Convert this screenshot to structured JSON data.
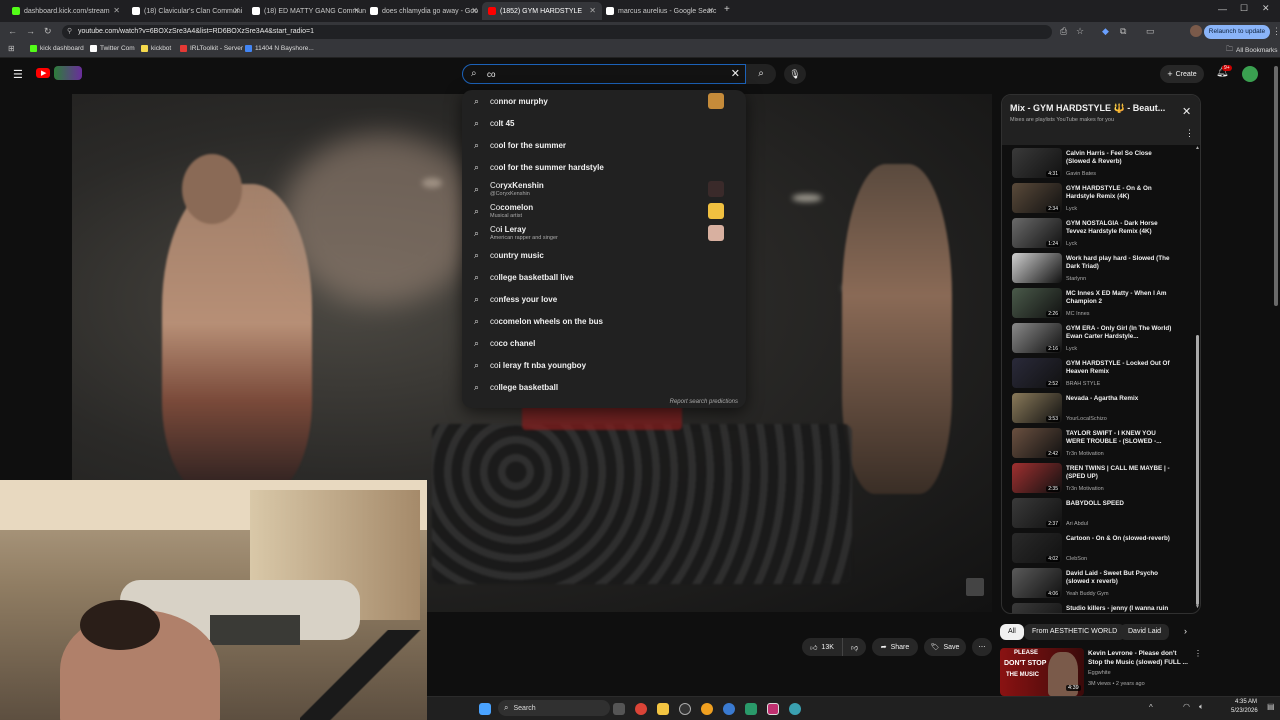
{
  "browser": {
    "tabs": [
      {
        "label": "dashboard.kick.com/stream",
        "favicon_color": "#53fc18",
        "active": false
      },
      {
        "label": "(18) Clavicular's Clan Communi",
        "favicon_color": "#ffffff",
        "active": false
      },
      {
        "label": "(18) ED MATTY GANG Commun",
        "favicon_color": "#ffffff",
        "active": false
      },
      {
        "label": "does chlamydia go away - Goo",
        "favicon_color": "#ffffff",
        "active": false
      },
      {
        "label": "(1852) GYM HARDSTYLE",
        "favicon_color": "#ff0000",
        "active": true
      },
      {
        "label": "marcus aurelius - Google Searc",
        "favicon_color": "#ffffff",
        "active": false
      }
    ],
    "new_tab_label": "+",
    "url": "youtube.com/watch?v=6BOXzSre3A4&list=RD6BOXzSre3A4&start_radio=1",
    "relaunch_label": "Relaunch to update",
    "bookmarks": [
      {
        "label": "kick dashboard",
        "color": "#53fc18"
      },
      {
        "label": "Twitter Com",
        "color": "#ffffff"
      },
      {
        "label": "kickbot",
        "color": "#f5d94c"
      },
      {
        "label": "IRLToolkit - Server",
        "color": "#e53935"
      },
      {
        "label": "11404 N Bayshore...",
        "color": "#4285f4"
      }
    ],
    "all_bookmarks_label": "All Bookmarks"
  },
  "youtube": {
    "search_value": "co",
    "create_label": "Create",
    "notification_count": "9+",
    "suggestions": [
      {
        "label": "connor murphy",
        "sub": "",
        "thumb": true,
        "thumb_color": "#c58b3a"
      },
      {
        "label": "colt 45",
        "sub": "",
        "thumb": false
      },
      {
        "label": "cool for the summer",
        "sub": "",
        "thumb": false
      },
      {
        "label": "cool for the summer hardstyle",
        "sub": "",
        "thumb": false
      },
      {
        "label": "CoryxKenshin",
        "sub": "@CoryxKenshin",
        "thumb": true,
        "thumb_color": "#3a2a2a"
      },
      {
        "label": "Cocomelon",
        "sub": "Musical artist",
        "thumb": true,
        "thumb_color": "#f0c040"
      },
      {
        "label": "Coi Leray",
        "sub": "American rapper and singer",
        "thumb": true,
        "thumb_color": "#d8b0a0"
      },
      {
        "label": "country music",
        "sub": "",
        "thumb": false
      },
      {
        "label": "college basketball live",
        "sub": "",
        "thumb": false
      },
      {
        "label": "confess your love",
        "sub": "",
        "thumb": false
      },
      {
        "label": "cocomelon wheels on the bus",
        "sub": "",
        "thumb": false
      },
      {
        "label": "coco chanel",
        "sub": "",
        "thumb": false
      },
      {
        "label": "coi leray ft nba youngboy",
        "sub": "",
        "thumb": false
      },
      {
        "label": "college basketball",
        "sub": "",
        "thumb": false
      }
    ],
    "report_label": "Report search predictions",
    "mix": {
      "title": "Mix - GYM HARDSTYLE 🔱 - Beaut...",
      "subtitle": "Mixes are playlists YouTube makes for you",
      "items": [
        {
          "title": "Calvin Harris - Feel So Close (Slowed & Reverb)",
          "channel": "Gavin Bates",
          "duration": "4:31",
          "color": "#3a3a3a"
        },
        {
          "title": "GYM HARDSTYLE - On & On Hardstyle Remix (4K)",
          "channel": "Lyck",
          "duration": "2:34",
          "color": "#5a4a3a"
        },
        {
          "title": "GYM NOSTALGIA - Dark Horse Tevvez Hardstyle Remix (4K)",
          "channel": "Lyck",
          "duration": "1:24",
          "color": "#6a6a6a"
        },
        {
          "title": "Work hard play hard - Slowed (The Dark Triad)",
          "channel": "Starlynn",
          "duration": "",
          "color": "#d0d0d0"
        },
        {
          "title": "MC Innes X ED Matty - When I Am Champion 2",
          "channel": "MC Innes",
          "duration": "2:26",
          "color": "#4a5a4a"
        },
        {
          "title": "GYM ERA - Only Girl (In The World) Ewan Carter Hardstyle...",
          "channel": "Lyck",
          "duration": "2:16",
          "color": "#8a8a8a"
        },
        {
          "title": "GYM HARDSTYLE - Locked Out Of Heaven Remix",
          "channel": "BRAH STYLE",
          "duration": "2:52",
          "color": "#2a2a3a"
        },
        {
          "title": "Nevada - Agartha Remix",
          "channel": "YourLocalSchizo",
          "duration": "3:53",
          "color": "#8a7a5a"
        },
        {
          "title": "TAYLOR SWIFT - I KNEW YOU WERE TROUBLE - (SLOWED -...",
          "channel": "Tr3n Motivation",
          "duration": "2:42",
          "color": "#6a5040"
        },
        {
          "title": "TREN TWINS | CALL ME MAYBE | - (SPED UP)",
          "channel": "Tr3n Motivation",
          "duration": "2:35",
          "color": "#a03030"
        },
        {
          "title": "BABYDOLL SPEED",
          "channel": "Ari Abdul",
          "duration": "2:37",
          "color": "#3a3a3a"
        },
        {
          "title": "Cartoon - On & On (slowed-reverb)",
          "channel": "ClebSon",
          "duration": "4:02",
          "color": "#2a2a2a"
        },
        {
          "title": "David Laid - Sweet But Psycho (slowed x reverb)",
          "channel": "Yeah Buddy Gym",
          "duration": "4:06",
          "color": "#5a5a5a"
        },
        {
          "title": "Studio killers - jenny (I wanna ruin our friendship) (Slowed...",
          "channel": "",
          "duration": "",
          "color": "#3a3a3a"
        }
      ]
    },
    "chips": [
      {
        "label": "All",
        "selected": true
      },
      {
        "label": "From AESTHETIC WORLD",
        "selected": false
      },
      {
        "label": "David Laid",
        "selected": false
      }
    ],
    "actions": {
      "likes": "13K",
      "share": "Share",
      "save": "Save"
    },
    "recommended": {
      "title": "Kevin Levrone - Please don't Stop the Music (slowed) FULL ...",
      "channel": "Eggwhite",
      "meta": "3M views • 2 years ago",
      "duration": "4:39",
      "thumb_text_top": "PLEASE",
      "thumb_text_mid": "DON'T STOP",
      "thumb_text_bot": "THE MUSIC"
    }
  },
  "taskbar": {
    "search_label": "Search",
    "time": "4:35 AM",
    "date": "5/23/2026"
  }
}
